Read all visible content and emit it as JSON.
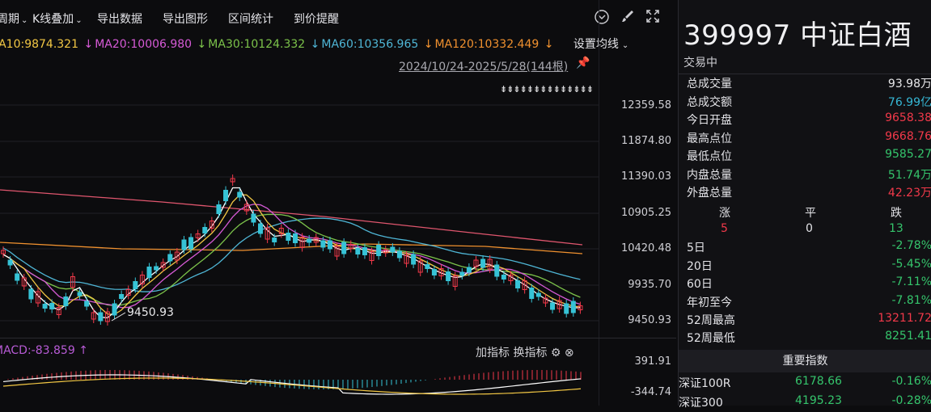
{
  "toolbar": {
    "period_label": "周期",
    "kline_overlay_label": "K线叠加",
    "export_data_label": "导出数据",
    "export_chart_label": "导出图形",
    "range_stats_label": "区间统计",
    "price_alert_label": "到价提醒"
  },
  "ma": {
    "ma10": "MA10:9874.321",
    "ma20": "MA20:10006.980",
    "ma30": "MA30:10124.332",
    "ma60": "MA60:10356.965",
    "ma120": "MA120:10332.449",
    "settings_label": "设置均线",
    "colors": {
      "ma10": "#f2c744",
      "ma20": "#d65ad6",
      "ma30": "#7cc34a",
      "ma60": "#4fb6d6",
      "ma120": "#f0912f"
    }
  },
  "range_text": "2024/10/24-2025/5/28(144根)",
  "marker_text": "⇟⇟⇟⇟⇟⇟⇟⇟⇟⇟⇟⇟⇟⇟",
  "price_axis": [
    "12359.58",
    "11874.80",
    "11390.03",
    "10905.25",
    "10420.48",
    "9935.70",
    "9450.93"
  ],
  "low_marker": "9450.93",
  "macd": {
    "label": "MACD:-83.859",
    "add_indicator_label": "加指标",
    "switch_indicator_label": "换指标",
    "axis_top": "391.91",
    "axis_bottom": "-344.74"
  },
  "stock": {
    "code": "399997",
    "name": "中证白酒",
    "status": "交易中"
  },
  "stats": [
    {
      "label": "总成交量",
      "value": "93.98万",
      "color": "white"
    },
    {
      "label": "总成交额",
      "value": "76.99亿",
      "color": "blue"
    },
    {
      "label": "今日开盘",
      "value": "9658.38",
      "color": "red"
    },
    {
      "label": "最高点位",
      "value": "9668.76",
      "color": "red"
    },
    {
      "label": "最低点位",
      "value": "9585.27",
      "color": "green"
    },
    {
      "label": "内盘总量",
      "value": "51.74万",
      "color": "green"
    },
    {
      "label": "外盘总量",
      "value": "42.23万",
      "color": "red"
    }
  ],
  "breadth": {
    "up_label": "涨",
    "flat_label": "平",
    "down_label": "跌",
    "up": "5",
    "flat": "0",
    "down": "13"
  },
  "performance": [
    {
      "label": "5日",
      "value": "-2.78%"
    },
    {
      "label": "20日",
      "value": "-5.45%"
    },
    {
      "label": "60日",
      "value": "-7.11%"
    },
    {
      "label": "年初至今",
      "value": "-7.81%"
    }
  ],
  "week52": {
    "high_label": "52周最高",
    "high": "13211.72",
    "low_label": "52周最低",
    "low": "8251.41"
  },
  "indices_header": "重要指数",
  "indices": [
    {
      "name": "深证100R",
      "price": "6178.66",
      "change": "-0.16%"
    },
    {
      "name": "深证300",
      "price": "4195.23",
      "change": "-0.28%"
    }
  ]
}
